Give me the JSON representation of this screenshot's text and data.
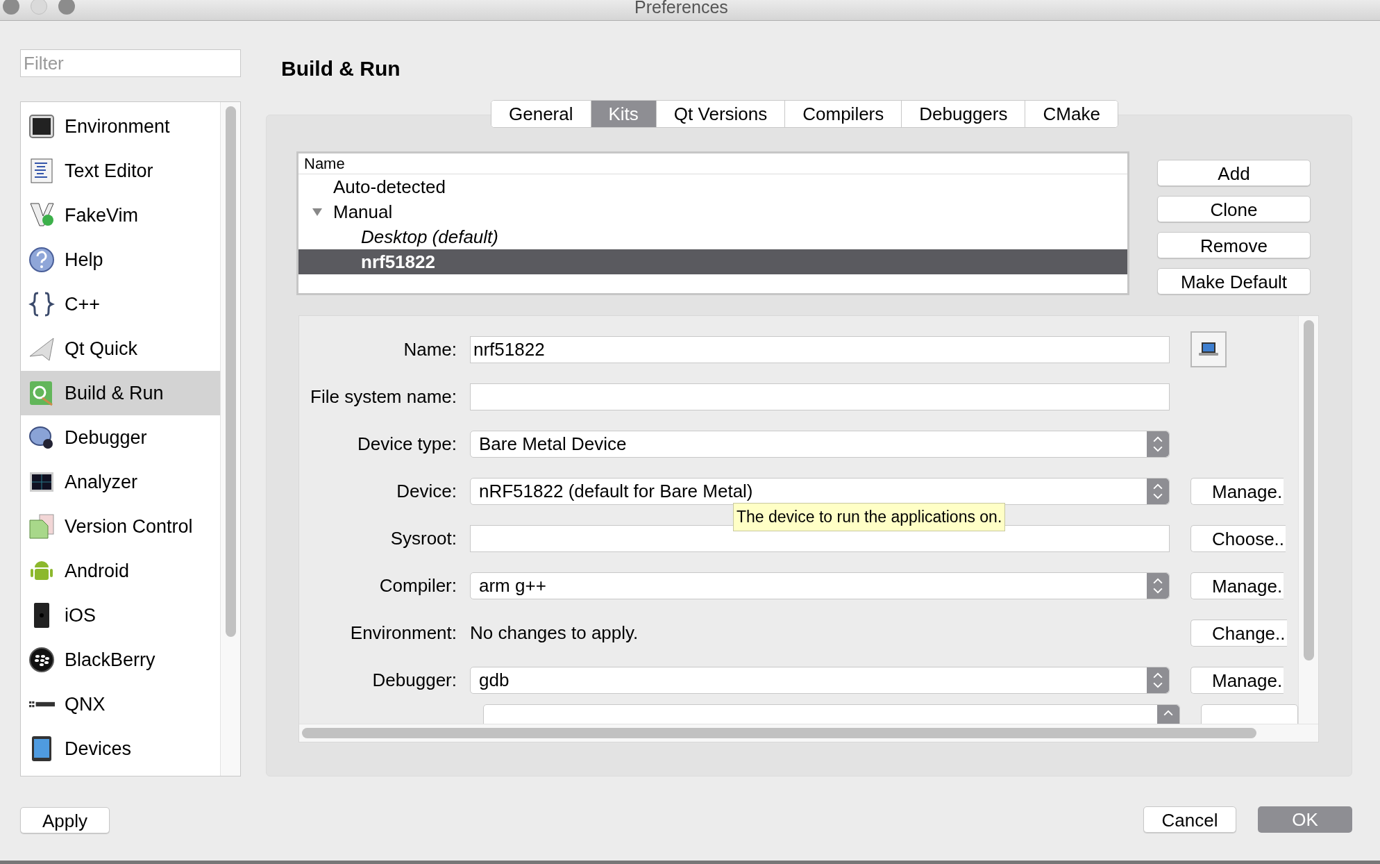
{
  "window": {
    "title": "Preferences"
  },
  "filter": {
    "placeholder": "Filter"
  },
  "sidebar": {
    "items": [
      {
        "label": "Environment",
        "selected": false
      },
      {
        "label": "Text Editor",
        "selected": false
      },
      {
        "label": "FakeVim",
        "selected": false
      },
      {
        "label": "Help",
        "selected": false
      },
      {
        "label": "C++",
        "selected": false
      },
      {
        "label": "Qt Quick",
        "selected": false
      },
      {
        "label": "Build & Run",
        "selected": true
      },
      {
        "label": "Debugger",
        "selected": false
      },
      {
        "label": "Analyzer",
        "selected": false
      },
      {
        "label": "Version Control",
        "selected": false
      },
      {
        "label": "Android",
        "selected": false
      },
      {
        "label": "iOS",
        "selected": false
      },
      {
        "label": "BlackBerry",
        "selected": false
      },
      {
        "label": "QNX",
        "selected": false
      },
      {
        "label": "Devices",
        "selected": false
      }
    ]
  },
  "page_title": "Build & Run",
  "tabs": [
    {
      "label": "General",
      "selected": false
    },
    {
      "label": "Kits",
      "selected": true
    },
    {
      "label": "Qt Versions",
      "selected": false
    },
    {
      "label": "Compilers",
      "selected": false
    },
    {
      "label": "Debuggers",
      "selected": false
    },
    {
      "label": "CMake",
      "selected": false
    }
  ],
  "kits_tree": {
    "columns": [
      "Name"
    ],
    "items": [
      {
        "label": "Auto-detected",
        "selected": false
      },
      {
        "label": "Manual",
        "selected": false,
        "expanded": true,
        "children": [
          {
            "label": "Desktop (default)",
            "selected": false,
            "is_default": true
          },
          {
            "label": "nrf51822",
            "selected": true,
            "is_default": false
          }
        ]
      }
    ]
  },
  "kit_buttons": [
    "Add",
    "Clone",
    "Remove",
    "Make Default"
  ],
  "form": {
    "rows": [
      {
        "label": "Name:",
        "kind": "text",
        "value": "nrf51822",
        "icon_button": true
      },
      {
        "label": "File system name:",
        "kind": "text",
        "value": ""
      },
      {
        "label": "Device type:",
        "kind": "combo",
        "value": "Bare Metal Device"
      },
      {
        "label": "Device:",
        "kind": "combo",
        "value": "nRF51822 (default for Bare Metal)",
        "action": "Manage."
      },
      {
        "label": "Sysroot:",
        "kind": "text",
        "value": "",
        "action": "Choose.."
      },
      {
        "label": "Compiler:",
        "kind": "combo",
        "value": "arm g++",
        "action": "Manage."
      },
      {
        "label": "Environment:",
        "kind": "label",
        "value": "No changes to apply.",
        "action": "Change.."
      },
      {
        "label": "Debugger:",
        "kind": "combo",
        "value": "gdb",
        "action": "Manage."
      }
    ]
  },
  "tooltip": "The device to run the applications on.",
  "footer": {
    "apply": "Apply",
    "cancel": "Cancel",
    "ok": "OK"
  }
}
